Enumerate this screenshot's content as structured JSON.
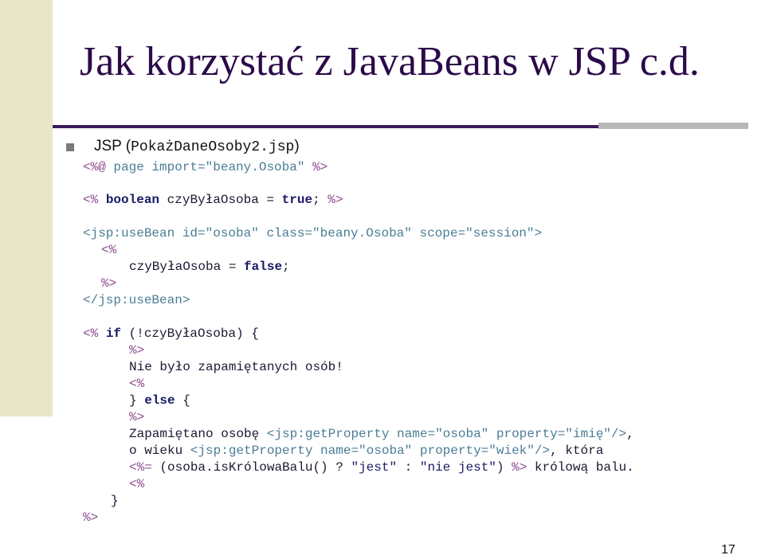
{
  "slide": {
    "title": "Jak korzystać z JavaBeans w JSP c.d.",
    "page_number": "17",
    "bullet": {
      "prefix": "JSP (",
      "filename": "PokażDaneOsoby2.jsp",
      "suffix": ")"
    },
    "code": {
      "l1": {
        "open": "<%@",
        "body": " page import=\"beany.Osoba\" ",
        "close": "%>"
      },
      "l2": {
        "open": "<%",
        "sp": " ",
        "kw": "boolean",
        "mid": " czyByłaOsoba = ",
        "val": "true",
        "semi": "; ",
        "close": "%>"
      },
      "l3": {
        "text": "<jsp:useBean id=\"osoba\" class=\"beany.Osoba\" scope=\"session\">"
      },
      "l4": {
        "text": "<%"
      },
      "l5": {
        "pre": "czyByłaOsoba = ",
        "val": "false",
        "semi": ";"
      },
      "l6": {
        "text": "%>"
      },
      "l7": {
        "text": "</jsp:useBean>"
      },
      "l8": {
        "open": "<%",
        "sp": " ",
        "kw": "if",
        "rest": " (!czyByłaOsoba) {"
      },
      "l9": {
        "text": "%>"
      },
      "l10": {
        "text": "Nie było zapamiętanych osób!"
      },
      "l11": {
        "text": "<%"
      },
      "l12": {
        "b1": "} ",
        "kw": "else",
        "b2": " {"
      },
      "l13": {
        "text": "%>"
      },
      "l14": {
        "pre": "Zapamiętano osobę ",
        "tag": "<jsp:getProperty name=\"osoba\" property=\"imię\"/>",
        "post": ","
      },
      "l15": {
        "pre": "o wieku ",
        "tag": "<jsp:getProperty name=\"osoba\" property=\"wiek\"/>",
        "post": ", która"
      },
      "l16": {
        "open": "<%=",
        "expr": " (osoba.isKrólowaBalu() ? ",
        "s1": "\"jest\"",
        "colon": " : ",
        "s2": "\"nie jest\"",
        "rp": ") ",
        "close": "%>",
        "post": " królową balu."
      },
      "l17": {
        "text": "<%"
      },
      "l18": {
        "text": "}"
      },
      "l19": {
        "text": "%>"
      }
    }
  }
}
